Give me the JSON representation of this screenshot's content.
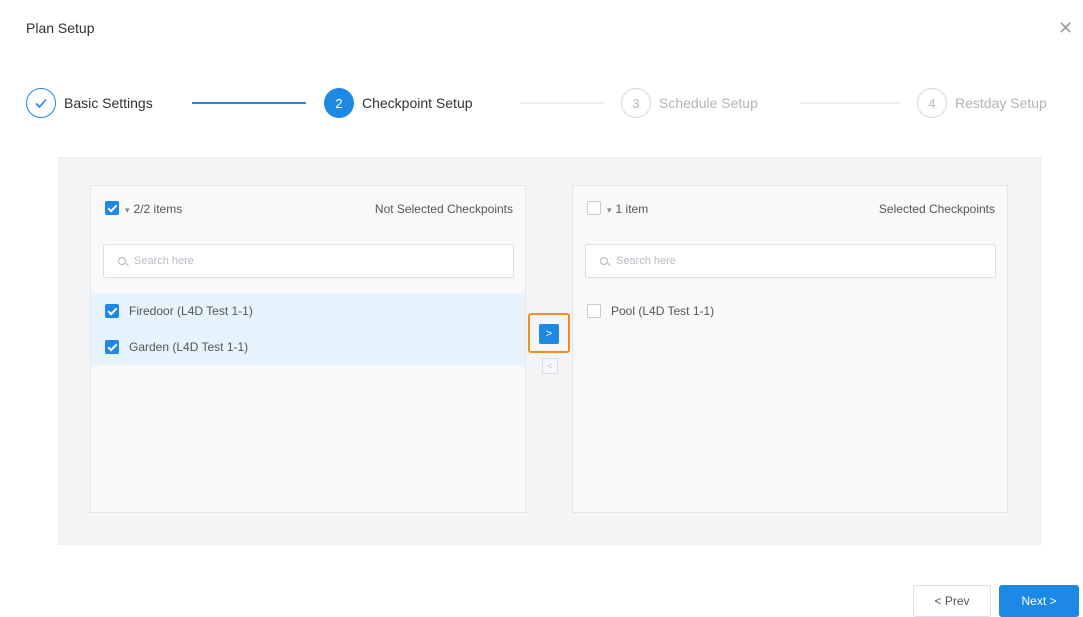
{
  "dialog": {
    "title": "Plan Setup",
    "close_icon": "close-icon"
  },
  "steps": [
    {
      "number": "",
      "label": "Basic Settings",
      "status": "done"
    },
    {
      "number": "2",
      "label": "Checkpoint Setup",
      "status": "active"
    },
    {
      "number": "3",
      "label": "Schedule Setup",
      "status": "wait"
    },
    {
      "number": "4",
      "label": "Restday Setup",
      "status": "wait"
    }
  ],
  "left_panel": {
    "count": "2/2 items",
    "title": "Not Selected Checkpoints",
    "all_checked": true,
    "search_placeholder": "Search here",
    "items": [
      {
        "label": "Firedoor (L4D Test 1-1)",
        "checked": true
      },
      {
        "label": "Garden (L4D Test 1-1)",
        "checked": true
      }
    ]
  },
  "right_panel": {
    "count": "1 item",
    "title": "Selected Checkpoints",
    "all_checked": false,
    "search_placeholder": "Search here",
    "items": [
      {
        "label": "Pool (L4D Test 1-1)",
        "checked": false
      }
    ]
  },
  "transfer": {
    "to_right": ">",
    "to_left": "<"
  },
  "footer": {
    "prev_label": "< Prev",
    "next_label": "Next >"
  },
  "colors": {
    "primary": "#1e88e5",
    "highlight": "#f28c28"
  }
}
